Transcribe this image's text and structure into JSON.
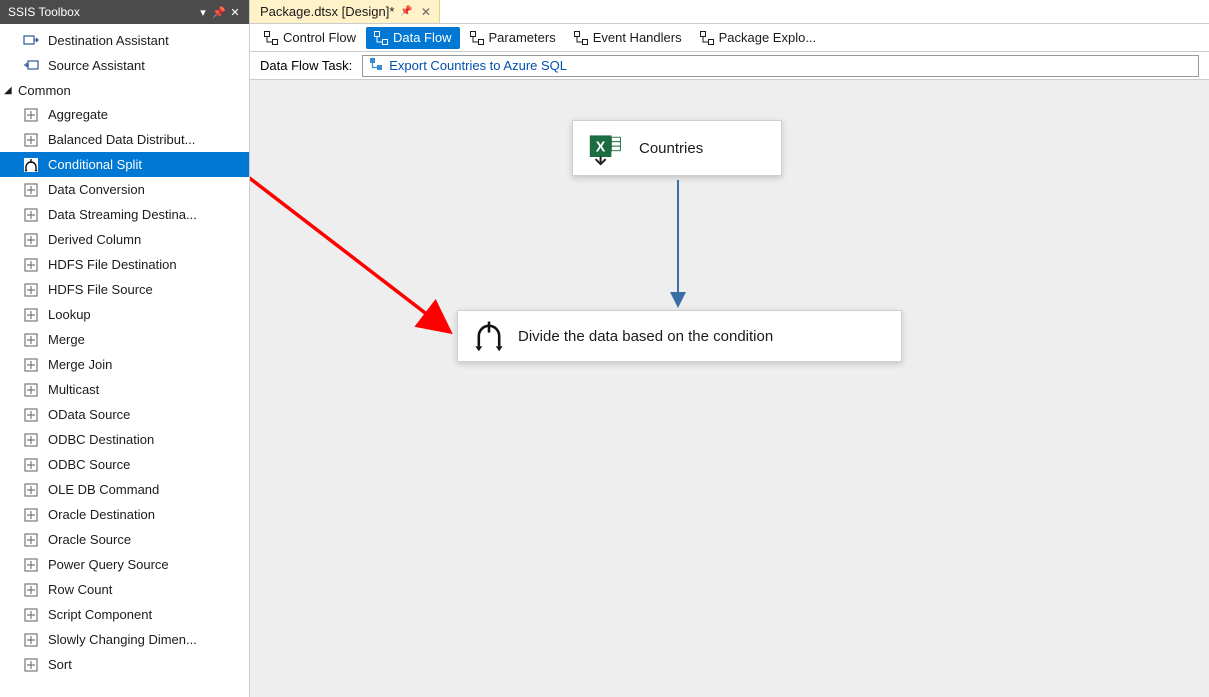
{
  "toolbox": {
    "title": "SSIS Toolbox",
    "assistants": [
      {
        "label": "Destination Assistant"
      },
      {
        "label": "Source Assistant"
      }
    ],
    "group_label": "Common",
    "items": [
      {
        "label": "Aggregate"
      },
      {
        "label": "Balanced Data Distribut..."
      },
      {
        "label": "Conditional Split",
        "selected": true
      },
      {
        "label": "Data Conversion"
      },
      {
        "label": "Data Streaming Destina..."
      },
      {
        "label": "Derived Column"
      },
      {
        "label": "HDFS File Destination"
      },
      {
        "label": "HDFS File Source"
      },
      {
        "label": "Lookup"
      },
      {
        "label": "Merge"
      },
      {
        "label": "Merge Join"
      },
      {
        "label": "Multicast"
      },
      {
        "label": "OData Source"
      },
      {
        "label": "ODBC Destination"
      },
      {
        "label": "ODBC Source"
      },
      {
        "label": "OLE DB Command"
      },
      {
        "label": "Oracle Destination"
      },
      {
        "label": "Oracle Source"
      },
      {
        "label": "Power Query Source"
      },
      {
        "label": "Row Count"
      },
      {
        "label": "Script Component"
      },
      {
        "label": "Slowly Changing Dimen..."
      },
      {
        "label": "Sort"
      }
    ]
  },
  "editor": {
    "tab_title": "Package.dtsx [Design]*",
    "inner_tabs": [
      {
        "label": "Control Flow"
      },
      {
        "label": "Data Flow",
        "active": true
      },
      {
        "label": "Parameters"
      },
      {
        "label": "Event Handlers"
      },
      {
        "label": "Package Explo..."
      }
    ],
    "task_label": "Data Flow Task:",
    "task_value": "Export Countries to Azure SQL"
  },
  "canvas": {
    "node_source": "Countries",
    "node_transform": "Divide the data based on the condition"
  }
}
